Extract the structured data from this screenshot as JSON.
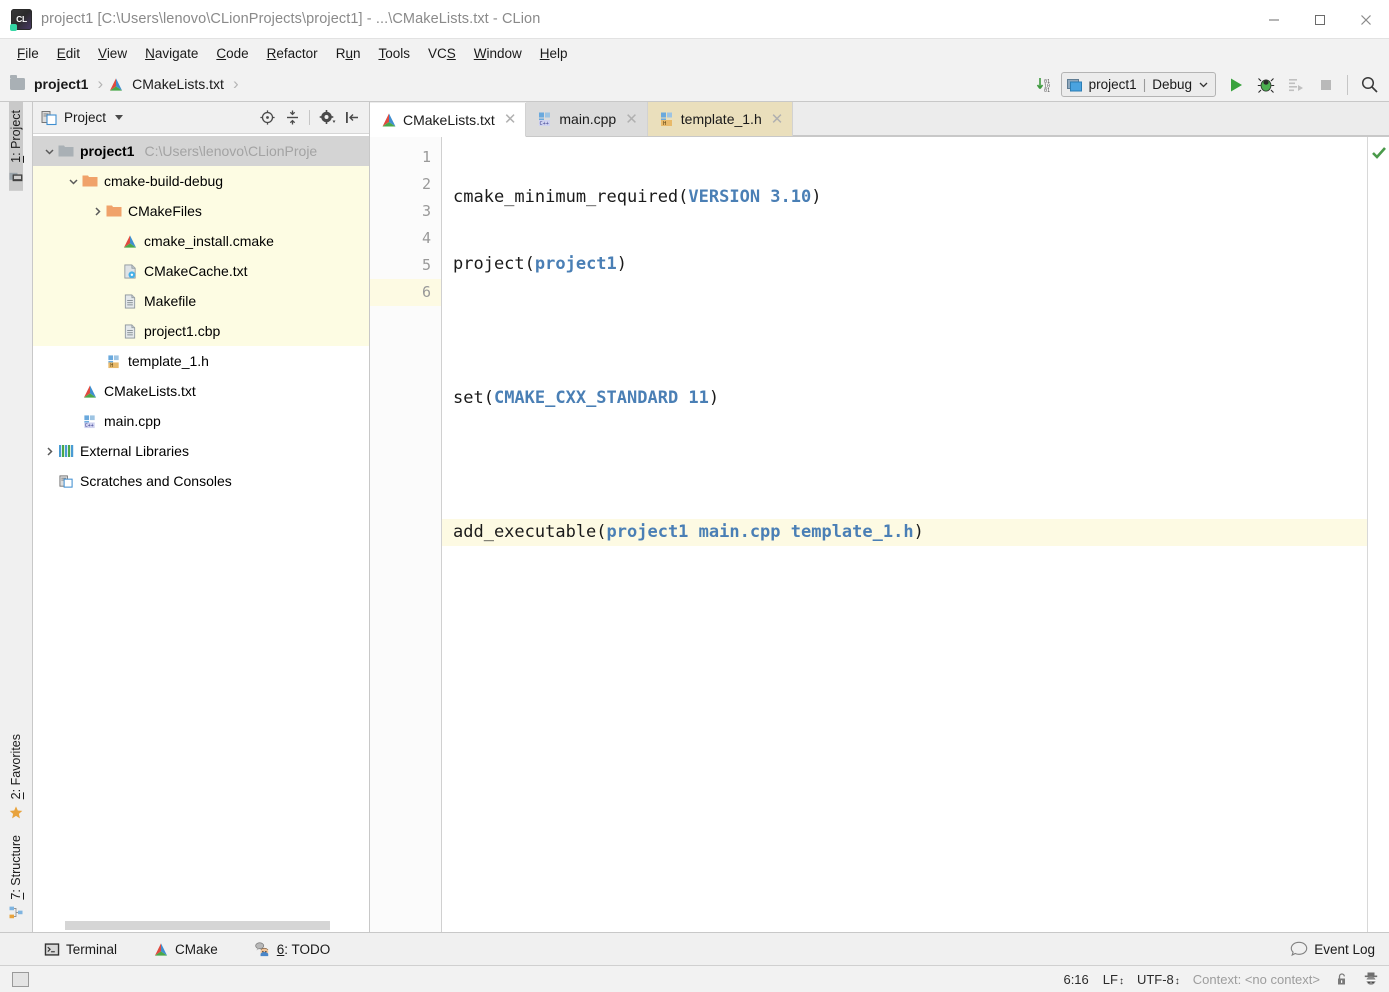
{
  "window": {
    "title": "project1 [C:\\Users\\lenovo\\CLionProjects\\project1] - ...\\CMakeLists.txt - CLion",
    "app_icon": "clion-logo-icon",
    "minimize_label": "Minimize",
    "maximize_label": "Maximize",
    "close_label": "Close"
  },
  "menubar": {
    "items": [
      {
        "label": "File",
        "mnemonic": "F"
      },
      {
        "label": "Edit",
        "mnemonic": "E"
      },
      {
        "label": "View",
        "mnemonic": "V"
      },
      {
        "label": "Navigate",
        "mnemonic": "N"
      },
      {
        "label": "Code",
        "mnemonic": "C"
      },
      {
        "label": "Refactor",
        "mnemonic": "R"
      },
      {
        "label": "Run",
        "mnemonic": "u"
      },
      {
        "label": "Tools",
        "mnemonic": "T"
      },
      {
        "label": "VCS",
        "mnemonic": "S"
      },
      {
        "label": "Window",
        "mnemonic": "W"
      },
      {
        "label": "Help",
        "mnemonic": "H"
      }
    ]
  },
  "navbar": {
    "breadcrumbs": [
      {
        "label": "project1",
        "icon": "folder-icon"
      },
      {
        "label": "CMakeLists.txt",
        "icon": "cmake-file-icon"
      }
    ],
    "separator": "›",
    "download_icon": "download-binary-icon",
    "run_configuration": {
      "icon": "run-config-icon",
      "project": "project1",
      "divider": "|",
      "build_type": "Debug",
      "dropdown_icon": "chevron-down-icon"
    },
    "actions": [
      {
        "name": "run-button",
        "icon": "play-icon",
        "label": "Run",
        "enabled": true
      },
      {
        "name": "debug-button",
        "icon": "bug-icon",
        "label": "Debug",
        "enabled": true
      },
      {
        "name": "run-with-coverage-button",
        "icon": "coverage-icon",
        "label": "Run with Coverage",
        "enabled": false
      },
      {
        "name": "stop-button",
        "icon": "stop-icon",
        "label": "Stop",
        "enabled": false
      },
      {
        "name": "search-everywhere-button",
        "icon": "search-icon",
        "label": "Search Everywhere",
        "enabled": true
      }
    ]
  },
  "left_stripe": {
    "top": [
      {
        "label": "1: Project",
        "mnemonic": "1",
        "icon": "project-icon",
        "active": true
      }
    ],
    "bottom": [
      {
        "label": "2: Favorites",
        "mnemonic": "2",
        "icon": "star-icon",
        "active": false
      },
      {
        "label": "7: Structure",
        "mnemonic": "7",
        "icon": "structure-icon",
        "active": false
      }
    ]
  },
  "project_panel": {
    "icon": "project-view-icon",
    "title": "Project",
    "dropdown_icon": "chevron-down-icon",
    "tools": [
      {
        "name": "scroll-from-source-button",
        "icon": "target-icon"
      },
      {
        "name": "collapse-all-button",
        "icon": "collapse-all-icon"
      },
      {
        "name": "settings-button",
        "icon": "gear-icon"
      },
      {
        "name": "hide-button",
        "icon": "hide-panel-icon"
      }
    ],
    "tree": [
      {
        "label": "project1",
        "path": "C:\\Users\\lenovo\\CLionProje",
        "icon": "folder-icon",
        "indent": 0,
        "arrow": "expanded",
        "state": "selected"
      },
      {
        "label": "cmake-build-debug",
        "path": "",
        "icon": "folder-orange-icon",
        "indent": 1,
        "arrow": "expanded",
        "state": "highlight"
      },
      {
        "label": "CMakeFiles",
        "path": "",
        "icon": "folder-orange-icon",
        "indent": 2,
        "arrow": "collapsed",
        "state": "highlight"
      },
      {
        "label": "cmake_install.cmake",
        "path": "",
        "icon": "cmake-file-icon",
        "indent": 3,
        "arrow": "none",
        "state": "highlight"
      },
      {
        "label": "CMakeCache.txt",
        "path": "",
        "icon": "cmake-cache-icon",
        "indent": 3,
        "arrow": "none",
        "state": "highlight"
      },
      {
        "label": "Makefile",
        "path": "",
        "icon": "text-file-icon",
        "indent": 3,
        "arrow": "none",
        "state": "highlight"
      },
      {
        "label": "project1.cbp",
        "path": "",
        "icon": "text-file-icon",
        "indent": 3,
        "arrow": "none",
        "state": "highlight"
      },
      {
        "label": "template_1.h",
        "path": "",
        "icon": "header-file-icon",
        "indent": 2,
        "arrow": "none",
        "state": "normal"
      },
      {
        "label": "CMakeLists.txt",
        "path": "",
        "icon": "cmake-file-icon",
        "indent": 1,
        "arrow": "none",
        "state": "normal"
      },
      {
        "label": "main.cpp",
        "path": "",
        "icon": "cpp-file-icon",
        "indent": 1,
        "arrow": "none",
        "state": "normal"
      },
      {
        "label": "External Libraries",
        "path": "",
        "icon": "libraries-icon",
        "indent": 0,
        "arrow": "collapsed",
        "state": "normal"
      },
      {
        "label": "Scratches and Consoles",
        "path": "",
        "icon": "scratches-icon",
        "indent": 0,
        "arrow": "none",
        "state": "normal"
      }
    ]
  },
  "editor": {
    "tabs": [
      {
        "label": "CMakeLists.txt",
        "icon": "cmake-file-icon",
        "state": "active",
        "close_icon": "close-icon"
      },
      {
        "label": "main.cpp",
        "icon": "cpp-file-icon",
        "state": "inactive",
        "close_icon": "close-icon"
      },
      {
        "label": "template_1.h",
        "icon": "header-file-icon",
        "state": "modified",
        "close_icon": "close-icon"
      }
    ],
    "inspection_status_icon": "green-check-icon",
    "current_line": 6,
    "line_numbers": [
      1,
      2,
      3,
      4,
      5,
      6
    ],
    "lines": [
      {
        "n": 1,
        "tokens": [
          {
            "t": "cmake_minimum_required(",
            "k": false
          },
          {
            "t": "VERSION 3.10",
            "k": true
          },
          {
            "t": ")",
            "k": false
          }
        ]
      },
      {
        "n": 2,
        "tokens": [
          {
            "t": "project(",
            "k": false
          },
          {
            "t": "project1",
            "k": true
          },
          {
            "t": ")",
            "k": false
          }
        ]
      },
      {
        "n": 3,
        "tokens": [
          {
            "t": "",
            "k": false
          }
        ]
      },
      {
        "n": 4,
        "tokens": [
          {
            "t": "set(",
            "k": false
          },
          {
            "t": "CMAKE_CXX_STANDARD 11",
            "k": true
          },
          {
            "t": ")",
            "k": false
          }
        ]
      },
      {
        "n": 5,
        "tokens": [
          {
            "t": "",
            "k": false
          }
        ]
      },
      {
        "n": 6,
        "tokens": [
          {
            "t": "add_executable(",
            "k": false
          },
          {
            "t": "project1 main.cpp template_1.h",
            "k": true
          },
          {
            "t": ")",
            "k": false
          }
        ]
      }
    ],
    "plain_text": "cmake_minimum_required(VERSION 3.10)\nproject(project1)\n\nset(CMAKE_CXX_STANDARD 11)\n\nadd_executable(project1 main.cpp template_1.h)"
  },
  "bottom_bar": {
    "buttons": [
      {
        "label": "Terminal",
        "icon": "terminal-icon",
        "mnemonic": ""
      },
      {
        "label": "CMake",
        "icon": "cmake-file-icon",
        "mnemonic": ""
      },
      {
        "label": "6: TODO",
        "icon": "todo-icon",
        "mnemonic": "6"
      }
    ],
    "event_log": {
      "label": "Event Log",
      "icon": "balloon-icon"
    }
  },
  "status_bar": {
    "widget_icon": "toggle-toolbar-icon",
    "caret_position": "6:16",
    "line_separator": "LF",
    "encoding": "UTF-8",
    "context": "Context: <no context>",
    "lock_icon": "unlocked-icon",
    "inspections_icon": "hector-icon",
    "stepper_glyph": "↕"
  },
  "colors": {
    "accent_blue": "#4a7fb5",
    "current_line": "#fdfae3",
    "tree_highlight": "#fdfce3",
    "tree_selection": "#d4d4d4",
    "run_green": "#38a23c",
    "folder_orange": "#f0a26a",
    "modified_tab": "#eadfbc",
    "titlebar_text": "#8a8a8a"
  }
}
